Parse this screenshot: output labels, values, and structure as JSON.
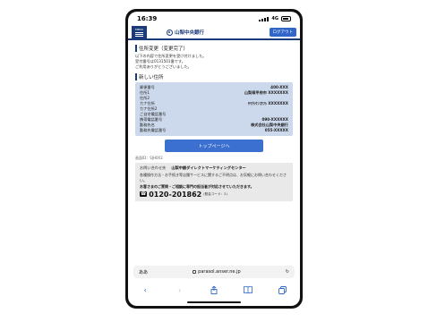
{
  "status_bar": {
    "time": "16:39",
    "network": "4G"
  },
  "header": {
    "menu_label": "MENU",
    "bank_name": "山梨中央銀行",
    "logout_label": "ログアウト"
  },
  "section1": {
    "title": "住所変更（変更完了）",
    "lines": [
      "以下の内容で住所変更を受け付けました。",
      "受付番号は0131501番です。",
      "ご利用ありがとうございました。"
    ]
  },
  "section2": {
    "title": "新しい住所",
    "rows": [
      {
        "label": "郵便番号",
        "value": "400-XXX"
      },
      {
        "label": "住所1",
        "value": "山梨県甲府市 XXXXXXX"
      },
      {
        "label": "住所2",
        "value": ""
      },
      {
        "label": "カナ住所",
        "value": "ﾔﾏﾅｼｹﾝｺｳﾌｼ XXXXXXX"
      },
      {
        "label": "カナ住所2",
        "value": ""
      },
      {
        "label": "ご自宅電話番号",
        "value": ""
      },
      {
        "label": "携帯電話番号",
        "value": "090-XXXXXX"
      },
      {
        "label": "勤務先名",
        "value": "株式会社山梨中央銀行"
      },
      {
        "label": "勤務先電話番号",
        "value": "055-XXXXX"
      }
    ]
  },
  "top_button_label": "トップページへ",
  "screen_id": "画面ID：SJH003",
  "contact": {
    "key_label": "お問い合わせ先",
    "name": "山梨中銀ダイレクトマーケティングセンター",
    "text1": "各種操作方法・お手続き等店舗サービスに関するご不明点は、お気軽にお問い合わせください。",
    "text2": "お客さまのご質問・ご相談に専門の担当者が対応させていただきます。",
    "tel_icon": "☎",
    "tel": "0120-201862",
    "tel_note": "(照会コード：2)"
  },
  "browser": {
    "aa_label": "ああ",
    "url": "parasol.anser.ne.jp"
  },
  "toolbar_icons": [
    "back-icon",
    "forward-icon",
    "share-icon",
    "bookmarks-icon",
    "tabs-icon"
  ]
}
